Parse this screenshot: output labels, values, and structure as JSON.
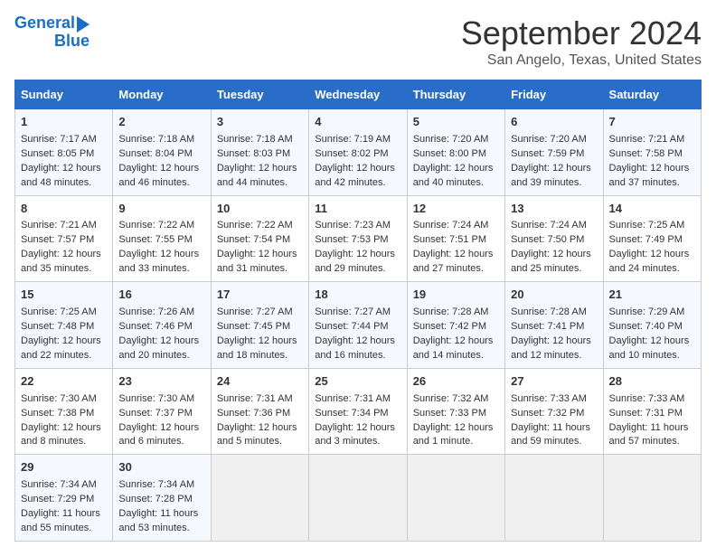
{
  "logo": {
    "line1": "General",
    "line2": "Blue"
  },
  "title": "September 2024",
  "subtitle": "San Angelo, Texas, United States",
  "days_header": [
    "Sunday",
    "Monday",
    "Tuesday",
    "Wednesday",
    "Thursday",
    "Friday",
    "Saturday"
  ],
  "weeks": [
    [
      {
        "day": "1",
        "lines": [
          "Sunrise: 7:17 AM",
          "Sunset: 8:05 PM",
          "Daylight: 12 hours",
          "and 48 minutes."
        ]
      },
      {
        "day": "2",
        "lines": [
          "Sunrise: 7:18 AM",
          "Sunset: 8:04 PM",
          "Daylight: 12 hours",
          "and 46 minutes."
        ]
      },
      {
        "day": "3",
        "lines": [
          "Sunrise: 7:18 AM",
          "Sunset: 8:03 PM",
          "Daylight: 12 hours",
          "and 44 minutes."
        ]
      },
      {
        "day": "4",
        "lines": [
          "Sunrise: 7:19 AM",
          "Sunset: 8:02 PM",
          "Daylight: 12 hours",
          "and 42 minutes."
        ]
      },
      {
        "day": "5",
        "lines": [
          "Sunrise: 7:20 AM",
          "Sunset: 8:00 PM",
          "Daylight: 12 hours",
          "and 40 minutes."
        ]
      },
      {
        "day": "6",
        "lines": [
          "Sunrise: 7:20 AM",
          "Sunset: 7:59 PM",
          "Daylight: 12 hours",
          "and 39 minutes."
        ]
      },
      {
        "day": "7",
        "lines": [
          "Sunrise: 7:21 AM",
          "Sunset: 7:58 PM",
          "Daylight: 12 hours",
          "and 37 minutes."
        ]
      }
    ],
    [
      {
        "day": "8",
        "lines": [
          "Sunrise: 7:21 AM",
          "Sunset: 7:57 PM",
          "Daylight: 12 hours",
          "and 35 minutes."
        ]
      },
      {
        "day": "9",
        "lines": [
          "Sunrise: 7:22 AM",
          "Sunset: 7:55 PM",
          "Daylight: 12 hours",
          "and 33 minutes."
        ]
      },
      {
        "day": "10",
        "lines": [
          "Sunrise: 7:22 AM",
          "Sunset: 7:54 PM",
          "Daylight: 12 hours",
          "and 31 minutes."
        ]
      },
      {
        "day": "11",
        "lines": [
          "Sunrise: 7:23 AM",
          "Sunset: 7:53 PM",
          "Daylight: 12 hours",
          "and 29 minutes."
        ]
      },
      {
        "day": "12",
        "lines": [
          "Sunrise: 7:24 AM",
          "Sunset: 7:51 PM",
          "Daylight: 12 hours",
          "and 27 minutes."
        ]
      },
      {
        "day": "13",
        "lines": [
          "Sunrise: 7:24 AM",
          "Sunset: 7:50 PM",
          "Daylight: 12 hours",
          "and 25 minutes."
        ]
      },
      {
        "day": "14",
        "lines": [
          "Sunrise: 7:25 AM",
          "Sunset: 7:49 PM",
          "Daylight: 12 hours",
          "and 24 minutes."
        ]
      }
    ],
    [
      {
        "day": "15",
        "lines": [
          "Sunrise: 7:25 AM",
          "Sunset: 7:48 PM",
          "Daylight: 12 hours",
          "and 22 minutes."
        ]
      },
      {
        "day": "16",
        "lines": [
          "Sunrise: 7:26 AM",
          "Sunset: 7:46 PM",
          "Daylight: 12 hours",
          "and 20 minutes."
        ]
      },
      {
        "day": "17",
        "lines": [
          "Sunrise: 7:27 AM",
          "Sunset: 7:45 PM",
          "Daylight: 12 hours",
          "and 18 minutes."
        ]
      },
      {
        "day": "18",
        "lines": [
          "Sunrise: 7:27 AM",
          "Sunset: 7:44 PM",
          "Daylight: 12 hours",
          "and 16 minutes."
        ]
      },
      {
        "day": "19",
        "lines": [
          "Sunrise: 7:28 AM",
          "Sunset: 7:42 PM",
          "Daylight: 12 hours",
          "and 14 minutes."
        ]
      },
      {
        "day": "20",
        "lines": [
          "Sunrise: 7:28 AM",
          "Sunset: 7:41 PM",
          "Daylight: 12 hours",
          "and 12 minutes."
        ]
      },
      {
        "day": "21",
        "lines": [
          "Sunrise: 7:29 AM",
          "Sunset: 7:40 PM",
          "Daylight: 12 hours",
          "and 10 minutes."
        ]
      }
    ],
    [
      {
        "day": "22",
        "lines": [
          "Sunrise: 7:30 AM",
          "Sunset: 7:38 PM",
          "Daylight: 12 hours",
          "and 8 minutes."
        ]
      },
      {
        "day": "23",
        "lines": [
          "Sunrise: 7:30 AM",
          "Sunset: 7:37 PM",
          "Daylight: 12 hours",
          "and 6 minutes."
        ]
      },
      {
        "day": "24",
        "lines": [
          "Sunrise: 7:31 AM",
          "Sunset: 7:36 PM",
          "Daylight: 12 hours",
          "and 5 minutes."
        ]
      },
      {
        "day": "25",
        "lines": [
          "Sunrise: 7:31 AM",
          "Sunset: 7:34 PM",
          "Daylight: 12 hours",
          "and 3 minutes."
        ]
      },
      {
        "day": "26",
        "lines": [
          "Sunrise: 7:32 AM",
          "Sunset: 7:33 PM",
          "Daylight: 12 hours",
          "and 1 minute."
        ]
      },
      {
        "day": "27",
        "lines": [
          "Sunrise: 7:33 AM",
          "Sunset: 7:32 PM",
          "Daylight: 11 hours",
          "and 59 minutes."
        ]
      },
      {
        "day": "28",
        "lines": [
          "Sunrise: 7:33 AM",
          "Sunset: 7:31 PM",
          "Daylight: 11 hours",
          "and 57 minutes."
        ]
      }
    ],
    [
      {
        "day": "29",
        "lines": [
          "Sunrise: 7:34 AM",
          "Sunset: 7:29 PM",
          "Daylight: 11 hours",
          "and 55 minutes."
        ]
      },
      {
        "day": "30",
        "lines": [
          "Sunrise: 7:34 AM",
          "Sunset: 7:28 PM",
          "Daylight: 11 hours",
          "and 53 minutes."
        ]
      },
      null,
      null,
      null,
      null,
      null
    ]
  ]
}
